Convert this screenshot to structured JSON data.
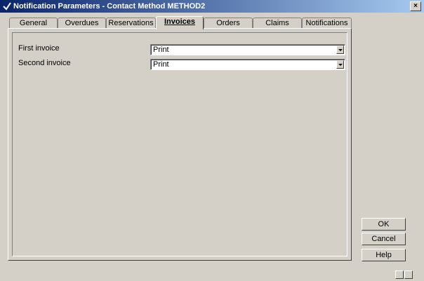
{
  "window": {
    "title": "Notification Parameters - Contact Method METHOD2",
    "close_glyph": "×"
  },
  "tabs": [
    {
      "label": "General"
    },
    {
      "label": "Overdues"
    },
    {
      "label": "Reservations"
    },
    {
      "label": "Invoices",
      "active": true
    },
    {
      "label": "Orders"
    },
    {
      "label": "Claims"
    },
    {
      "label": "Notifications"
    }
  ],
  "form": {
    "first_invoice_label": "First invoice",
    "first_invoice_value": "Print",
    "second_invoice_label": "Second invoice",
    "second_invoice_value": "Print"
  },
  "buttons": {
    "ok": "OK",
    "cancel": "Cancel",
    "help": "Help"
  },
  "icons": {
    "app": "app-icon",
    "status_a": "keyboard-icon",
    "status_b": "resize-icon"
  }
}
